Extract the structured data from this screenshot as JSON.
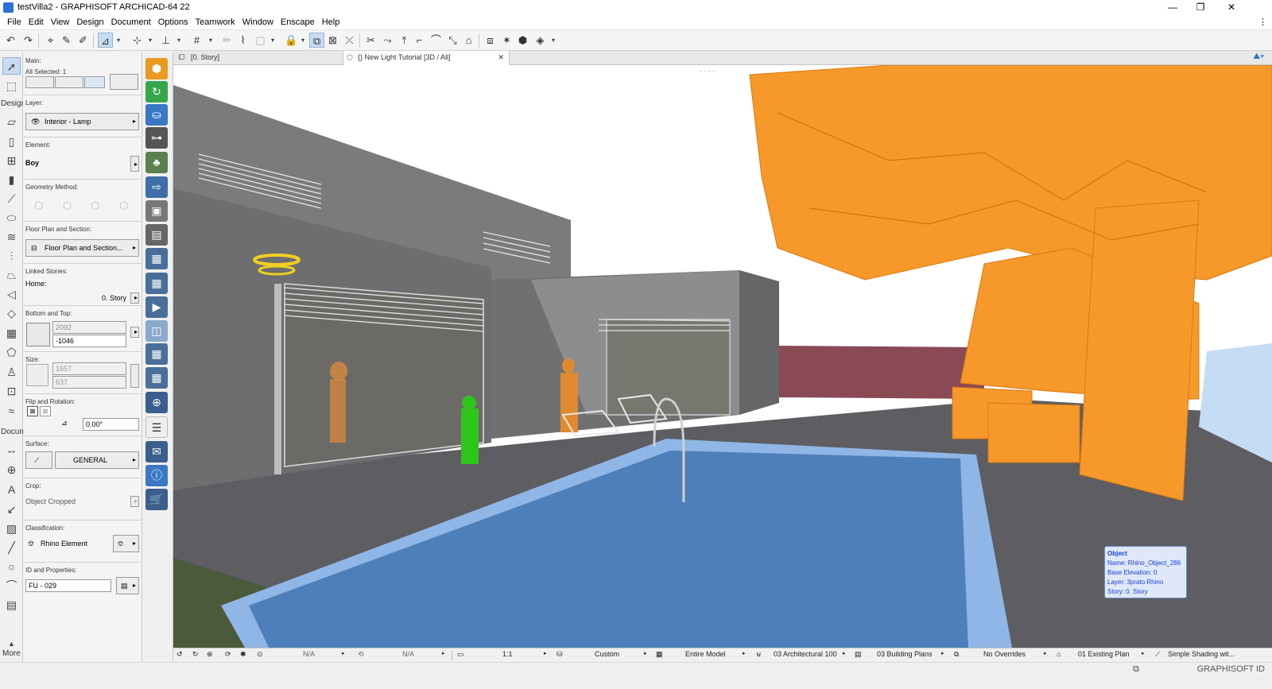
{
  "window": {
    "title": "testVilla2 - GRAPHISOFT ARCHICAD-64 22",
    "controls": {
      "minimize": "—",
      "restore": "❐",
      "close": "✕"
    }
  },
  "menu": {
    "items": [
      "File",
      "Edit",
      "View",
      "Design",
      "Document",
      "Options",
      "Teamwork",
      "Window",
      "Enscape",
      "Help"
    ],
    "right_glyph": "⋮"
  },
  "toolbox": {
    "design_label": "Design",
    "document_label": "Docum",
    "more_label": "More"
  },
  "infobox": {
    "main_label": "Main:",
    "all_selected": "All Selected: 1",
    "layer_label": "Layer:",
    "layer_value": "Interior - Lamp",
    "element_label": "Element:",
    "element_value": "Boy",
    "geometry_label": "Geometry Method:",
    "floorplan_label": "Floor Plan and Section:",
    "floorplan_value": "Floor Plan and Section...",
    "linked_label": "Linked Stories:",
    "home_label": "Home:",
    "home_value": "0. Story",
    "bottomtop_label": "Bottom and Top:",
    "top_value": "2092",
    "bottom_value": "-1046",
    "size_label": "Size:",
    "size_a": "1657",
    "size_b": "637",
    "flip_label": "Flip and Rotation:",
    "rotation_value": "0.00°",
    "surface_label": "Surface:",
    "surface_value": "GENERAL",
    "crop_label": "Crop:",
    "crop_value": "Object Cropped",
    "class_label": "Classification:",
    "class_value": "Rhino Element",
    "id_label": "ID and Properties:",
    "id_value": "FU - 029"
  },
  "tabs": [
    {
      "label": "[0. Story]",
      "active": false
    },
    {
      "label": "{} New Light Tutorial [3D / All]",
      "active": true,
      "close": "✕"
    }
  ],
  "tooltip": {
    "title": "Object",
    "name": "Name: Rhino_Object_286",
    "base": "Base Elevation: 0",
    "layer": "Layer: 3prato.Rhino",
    "story": "Story: 0. Story"
  },
  "statusbar": {
    "na1": "N/A",
    "na2": "N/A",
    "scale": "1:1",
    "custom": "Custom",
    "model": "Entire Model",
    "layer_combo": "03 Architectural 100",
    "pen_set": "03 Building Plans",
    "overrides": "No Overrides",
    "renovation": "01 Existing Plan",
    "shading": "Simple Shading wit..."
  },
  "footer": {
    "graphisoft_id": "GRAPHISOFT ID"
  },
  "colors": {
    "selection_orange": "#f7982a",
    "selected_figure_green": "#2ec51a",
    "pool_blue": "#4f7fb8",
    "tooltip_text": "#1b3ed6"
  }
}
